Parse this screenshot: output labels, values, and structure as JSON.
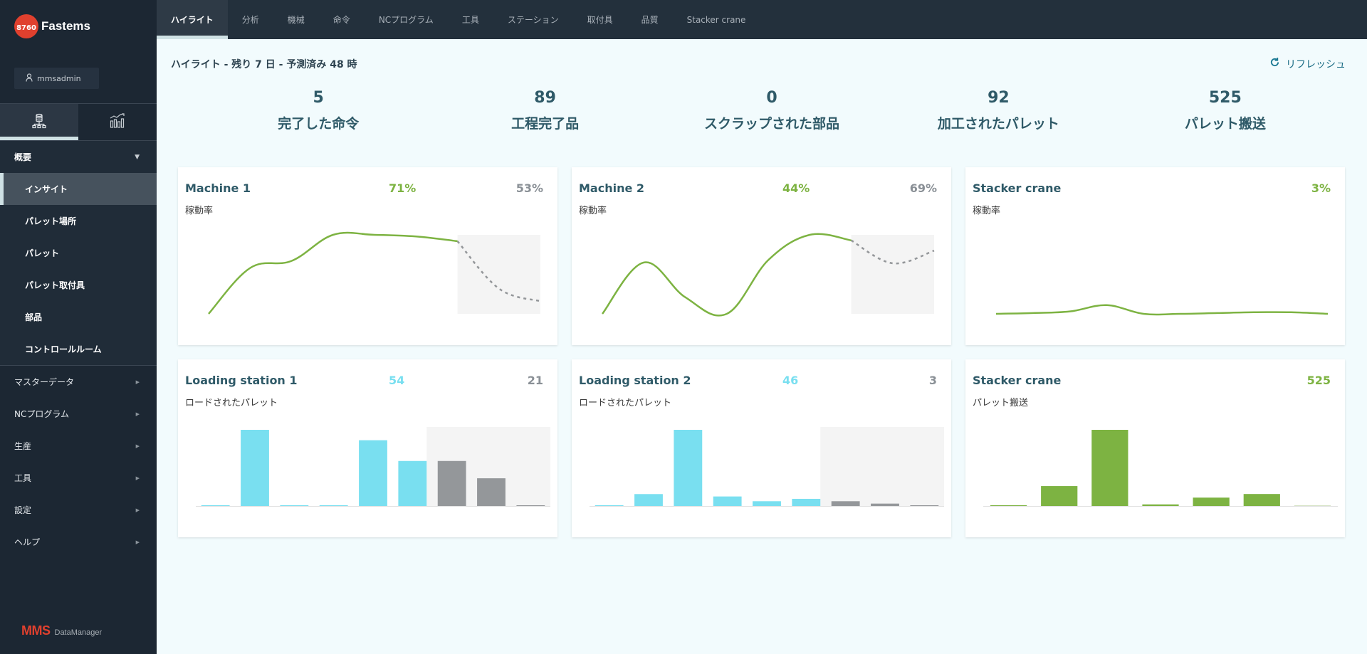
{
  "app": {
    "badge": "8760",
    "name": "Fastems",
    "user": "mmsadmin",
    "footer_brand": "MMS",
    "footer_product": "DataManager"
  },
  "side_tabs": [
    {
      "icon": "database-network-icon",
      "active": true
    },
    {
      "icon": "chart-trend-icon",
      "active": false
    }
  ],
  "nav": {
    "section": {
      "label": "概要",
      "expanded": true
    },
    "items": [
      {
        "label": "インサイト",
        "active": true
      },
      {
        "label": "パレット場所",
        "active": false
      },
      {
        "label": "パレット",
        "active": false
      },
      {
        "label": "パレット取付具",
        "active": false
      },
      {
        "label": "部品",
        "active": false
      },
      {
        "label": "コントロールルーム",
        "active": false
      }
    ],
    "groups": [
      {
        "label": "マスターデータ"
      },
      {
        "label": "NCプログラム"
      },
      {
        "label": "生産"
      },
      {
        "label": "工具"
      },
      {
        "label": "設定"
      },
      {
        "label": "ヘルプ"
      }
    ]
  },
  "top_tabs": [
    {
      "label": "ハイライト",
      "active": true
    },
    {
      "label": "分析",
      "active": false
    },
    {
      "label": "機械",
      "active": false
    },
    {
      "label": "命令",
      "active": false
    },
    {
      "label": "NCプログラム",
      "active": false
    },
    {
      "label": "工具",
      "active": false
    },
    {
      "label": "ステーション",
      "active": false
    },
    {
      "label": "取付具",
      "active": false
    },
    {
      "label": "品質",
      "active": false
    },
    {
      "label": "Stacker crane",
      "active": false
    }
  ],
  "header": {
    "title": "ハイライト - 残り 7 日 - 予測済み 48 時",
    "refresh_label": "リフレッシュ"
  },
  "kpis": [
    {
      "value": "5",
      "label": "完了した命令"
    },
    {
      "value": "89",
      "label": "工程完了品"
    },
    {
      "value": "0",
      "label": "スクラップされた部品"
    },
    {
      "value": "92",
      "label": "加工されたパレット"
    },
    {
      "value": "525",
      "label": "パレット搬送"
    }
  ],
  "colors": {
    "green": "#7db342",
    "cyan": "#79dff0",
    "gray": "#94979a",
    "forecast_bg": "#f4f4f4"
  },
  "cards": [
    {
      "title": "Machine 1",
      "subtitle": "稼動率",
      "value_actual": "71%",
      "value_forecast": "53%",
      "chart": {
        "type": "line",
        "ylim": [
          0,
          100
        ],
        "actual": [
          0,
          58,
          67,
          100,
          100,
          98,
          92
        ],
        "forecast": [
          92,
          32,
          16
        ]
      }
    },
    {
      "title": "Machine 2",
      "subtitle": "稼動率",
      "value_actual": "44%",
      "value_forecast": "69%",
      "chart": {
        "type": "line",
        "ylim": [
          0,
          100
        ],
        "actual": [
          0,
          65,
          21,
          0,
          68,
          100,
          93
        ],
        "forecast": [
          93,
          64,
          80
        ]
      }
    },
    {
      "title": "Stacker crane",
      "subtitle": "稼動率",
      "value_actual": "3%",
      "value_forecast": "",
      "chart": {
        "type": "line",
        "ylim": [
          0,
          100
        ],
        "actual": [
          0,
          1,
          3,
          11,
          0,
          0,
          1,
          2,
          2,
          0
        ],
        "forecast": []
      }
    },
    {
      "title": "Loading station 1",
      "subtitle": "ロードされたパレット",
      "value_actual": "54",
      "value_forecast": "21",
      "chart": {
        "type": "bar",
        "actual": [
          0,
          22,
          0,
          0,
          19,
          13
        ],
        "forecast": [
          13,
          8,
          0
        ]
      }
    },
    {
      "title": "Loading station 2",
      "subtitle": "ロードされたパレット",
      "value_actual": "46",
      "value_forecast": "3",
      "chart": {
        "type": "bar",
        "actual": [
          0,
          5,
          32,
          4,
          2,
          3
        ],
        "forecast": [
          2,
          1,
          0
        ]
      }
    },
    {
      "title": "Stacker crane",
      "subtitle": "パレット搬送",
      "value_actual": "525",
      "value_forecast": "",
      "chart": {
        "type": "bar",
        "actual": [
          0,
          88,
          337,
          7,
          37,
          53,
          3
        ],
        "forecast": []
      }
    }
  ]
}
